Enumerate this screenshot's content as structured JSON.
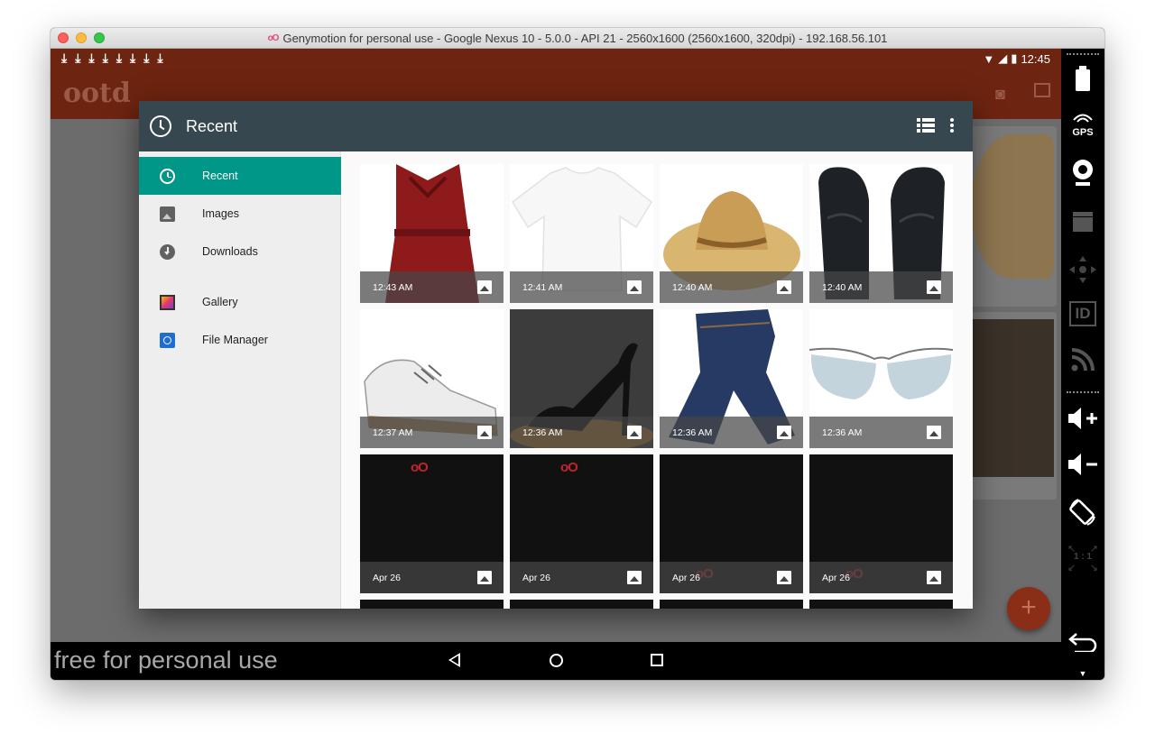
{
  "window": {
    "title": "Genymotion for personal use - Google Nexus 10 - 5.0.0 - API 21 - 2560x1600 (2560x1600, 320dpi) - 192.168.56.101"
  },
  "statusbar": {
    "time": "12:45",
    "download_count": 8
  },
  "app": {
    "logo": "ootd"
  },
  "picker": {
    "title": "Recent",
    "drawer": [
      {
        "label": "Recent",
        "icon": "clock-icon",
        "active": true
      },
      {
        "label": "Images",
        "icon": "image-icon",
        "active": false
      },
      {
        "label": "Downloads",
        "icon": "download-icon",
        "active": false
      },
      {
        "label": "Gallery",
        "icon": "gallery-icon",
        "active": false
      },
      {
        "label": "File Manager",
        "icon": "file-manager-icon",
        "active": false
      }
    ],
    "grid": [
      {
        "caption": "12:43 AM",
        "subject": "red-dress"
      },
      {
        "caption": "12:41 AM",
        "subject": "white-tshirt"
      },
      {
        "caption": "12:40 AM",
        "subject": "straw-hat"
      },
      {
        "caption": "12:40 AM",
        "subject": "leather-mittens"
      },
      {
        "caption": "12:37 AM",
        "subject": "white-sneakers"
      },
      {
        "caption": "12:36 AM",
        "subject": "black-heel"
      },
      {
        "caption": "12:36 AM",
        "subject": "blue-jeans"
      },
      {
        "caption": "12:36 AM",
        "subject": "sunglasses"
      },
      {
        "caption": "Apr 26",
        "subject": "screenshot"
      },
      {
        "caption": "Apr 26",
        "subject": "screenshot"
      },
      {
        "caption": "Apr 26",
        "subject": "screenshot"
      },
      {
        "caption": "Apr 26",
        "subject": "screenshot"
      }
    ]
  },
  "navbar": {
    "watermark": "free for personal use"
  },
  "sidepanel": {
    "gps_label": "GPS",
    "id_label": "ID",
    "scale_label": "1 : 1"
  }
}
